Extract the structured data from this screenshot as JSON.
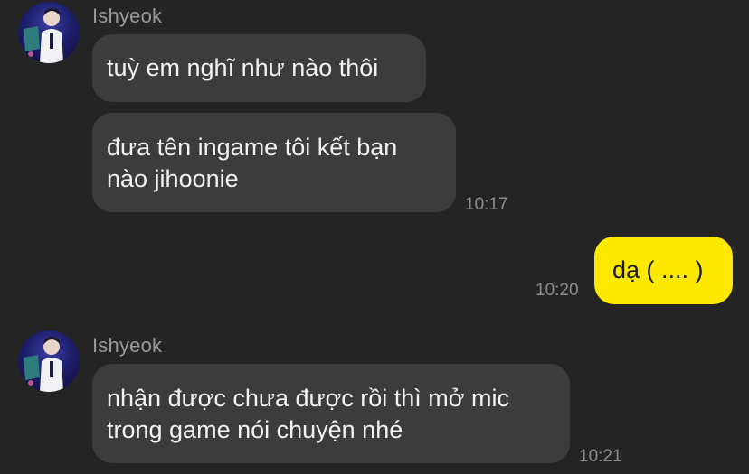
{
  "colors": {
    "background": "#242424",
    "incoming_bubble": "#3c3c3c",
    "outgoing_bubble": "#fde800",
    "timestamp_text": "#8e8e8e",
    "sender_text": "#9a9a9a"
  },
  "messages": {
    "group1": {
      "sender": "Ishyeok",
      "bubble1": {
        "line1": "tuỳ em nghĩ như nào thôi"
      },
      "bubble2": {
        "line1": "đưa tên ingame tôi kết bạn",
        "line2": "nào jihoonie"
      },
      "time": "10:17"
    },
    "outgoing1": {
      "text": "dạ ( .... )",
      "time": "10:20"
    },
    "group2": {
      "sender": "Ishyeok",
      "bubble1": {
        "line1": "nhận được chưa được rồi thì mở mic",
        "line2": "trong game nói chuyện nhé"
      },
      "time": "10:21"
    }
  }
}
